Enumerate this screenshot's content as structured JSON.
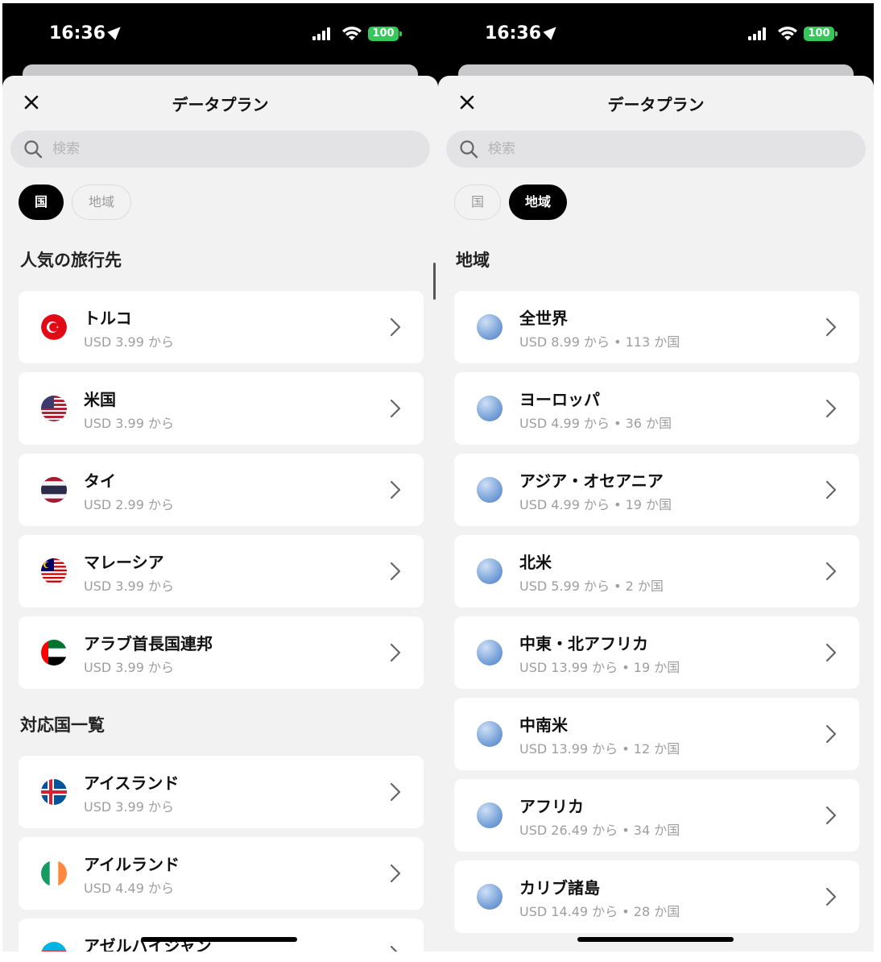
{
  "status_bar": {
    "time": "16:36",
    "battery": "100"
  },
  "left": {
    "title": "データプラン",
    "search_placeholder": "検索",
    "chips": [
      "国",
      "地域"
    ],
    "sections": [
      {
        "title": "人気の旅行先",
        "items": [
          {
            "name": "トルコ",
            "price": "USD 3.99 から",
            "flag": "turkey"
          },
          {
            "name": "米国",
            "price": "USD 3.99 から",
            "flag": "usa"
          },
          {
            "name": "タイ",
            "price": "USD 2.99 から",
            "flag": "thailand"
          },
          {
            "name": "マレーシア",
            "price": "USD 3.99 から",
            "flag": "malaysia"
          },
          {
            "name": "アラブ首長国連邦",
            "price": "USD 3.99 から",
            "flag": "uae"
          }
        ]
      },
      {
        "title": "対応国一覧",
        "items": [
          {
            "name": "アイスランド",
            "price": "USD 3.99 から",
            "flag": "iceland"
          },
          {
            "name": "アイルランド",
            "price": "USD 4.49 から",
            "flag": "ireland"
          },
          {
            "name": "アゼルバイジャン",
            "price": "",
            "flag": "azerbaijan"
          }
        ]
      }
    ]
  },
  "right": {
    "title": "データプラン",
    "search_placeholder": "検索",
    "chips": [
      "国",
      "地域"
    ],
    "section_title": "地域",
    "items": [
      {
        "name": "全世界",
        "price": "USD 8.99 から • 113 か国",
        "icon": "globe-icon"
      },
      {
        "name": "ヨーロッパ",
        "price": "USD 4.99 から • 36 か国",
        "icon": "globe-europe-icon"
      },
      {
        "name": "アジア・オセアニア",
        "price": "USD 4.99 から • 19 か国",
        "icon": "globe-asia-icon"
      },
      {
        "name": "北米",
        "price": "USD 5.99 から • 2 か国",
        "icon": "globe-americas-icon"
      },
      {
        "name": "中東・北アフリカ",
        "price": "USD 13.99 から • 19 か国",
        "icon": "globe-mena-icon"
      },
      {
        "name": "中南米",
        "price": "USD 13.99 から • 12 か国",
        "icon": "globe-latam-icon"
      },
      {
        "name": "アフリカ",
        "price": "USD 26.49 から • 34 か国",
        "icon": "globe-africa-icon"
      },
      {
        "name": "カリブ諸島",
        "price": "USD 14.49 から • 28 か国",
        "icon": "globe-caribbean-icon"
      }
    ]
  },
  "colors": {
    "sheet": "#f2f2f2",
    "card": "#ffffff",
    "chip_active": "#000000",
    "battery": "#35c759",
    "muted_text": "#9e9e9e"
  }
}
